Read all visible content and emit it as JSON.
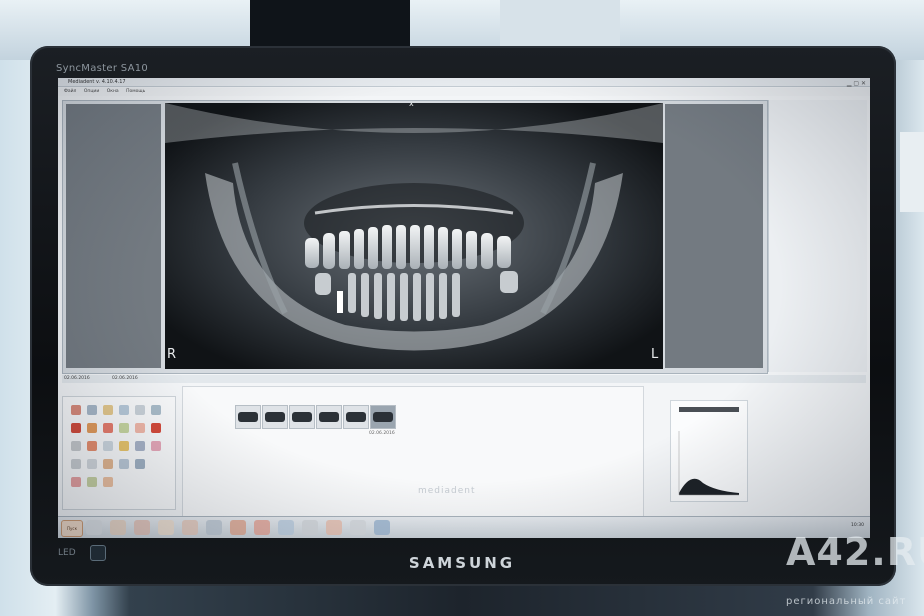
{
  "monitor": {
    "model_label": "SyncMaster SA10",
    "brand": "SAMSUNG",
    "led_label": "LED"
  },
  "app": {
    "title": "Mediadent v. 4.10.4.17",
    "menu": [
      "Файл",
      "Опции",
      "Окна",
      "Помощь"
    ],
    "orientation_left": "R",
    "orientation_right": "L",
    "top_marker": "x",
    "info_date_1": "02.06.2016",
    "info_date_2": "02.06.2016",
    "thumb_dates": [
      "",
      "",
      "",
      "",
      "",
      "02.06.2016"
    ],
    "software_watermark": "mediadent",
    "tray_time": "10:30",
    "start_label": "Пуск"
  },
  "colors": {
    "bezel": "#0c0e11",
    "screen_bg": "#f3f5f7",
    "xray_bg": "#0b0d10",
    "side_panel": "#737a81"
  },
  "watermark": {
    "main": "A42.RU",
    "sub": "региональный сайт"
  }
}
